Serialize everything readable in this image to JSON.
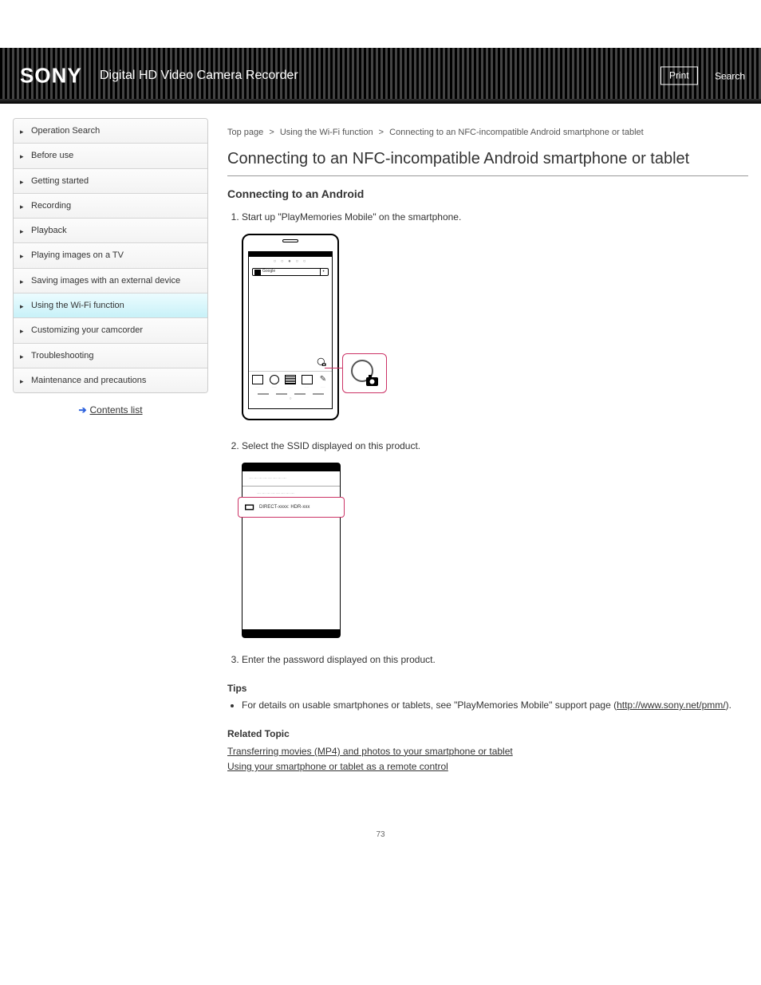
{
  "header": {
    "brand": "SONY",
    "product": "Digital HD Video Camera Recorder",
    "printBtn": "Print",
    "searchBtn": "Search"
  },
  "sidebar": [
    "Operation Search",
    "Before use",
    "Getting started",
    "Recording",
    "Playback",
    "Playing images on a TV",
    "Saving images with an external device",
    "Using the Wi-Fi function",
    "Customizing your camcorder",
    "Troubleshooting",
    "Maintenance and precautions"
  ],
  "sidebarActiveIndex": 7,
  "sidebarFoot": "Contents list",
  "crumbs": [
    "Top page",
    "Using the Wi-Fi function",
    "Connecting to an NFC-incompatible Android smartphone or tablet"
  ],
  "title": "Connecting to an NFC-incompatible Android smartphone or tablet",
  "subtitle": "Connecting to an Android",
  "steps": {
    "s1": "Start up \"PlayMemories Mobile\" on the smartphone.",
    "s2": "Select the SSID displayed on this product.",
    "s3": "Enter the password displayed on this product."
  },
  "figtext": {
    "google": "Google",
    "direct": "DIRECT-xxxx: HDR-xxx"
  },
  "tipsHeading": "Tips",
  "tips": {
    "t1_a": "For details on usable smartphones or tablets, see \"PlayMemories Mobile\" support page (",
    "t1_url": "http://www.sony.net/pmm/",
    "t1_b": ")."
  },
  "related": {
    "heading": "Related Topic",
    "r1": "Transferring movies (MP4) and photos to your smartphone or tablet",
    "r2": "Using your smartphone or tablet as a remote control"
  },
  "pageNum": "73"
}
